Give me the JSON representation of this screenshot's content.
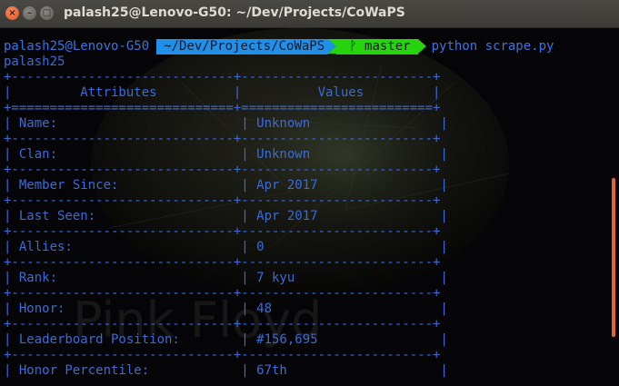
{
  "window": {
    "title": "palash25@Lenovo-G50: ~/Dev/Projects/CoWaPS"
  },
  "prompt": {
    "user_host": "palash25@Lenovo-G50",
    "directory": "~/Dev/Projects/CoWaPS",
    "branch": "master",
    "branch_icon": "git-branch-icon",
    "command": "python scrape.py"
  },
  "output_user": "palash25",
  "table": {
    "border": "+-----------------------------+-------------------------+",
    "header_sep": "+=============================+=========================+",
    "header": "|         Attributes          |          Values         |",
    "rows": [
      "| Name:                        | Unknown                 |",
      "| Clan:                        | Unknown                 |",
      "| Member Since:                | Apr 2017                |",
      "| Last Seen:                   | Apr 2017                |",
      "| Allies:                      | 0                       |",
      "| Rank:                        | 7 kyu                   |",
      "| Honor:                       | 48                      |",
      "| Leaderboard Position:        | #156,695                |",
      "| Honor Percentile:            | 67th                    |"
    ],
    "header_cells": [
      "Attributes",
      "Values"
    ],
    "cells": [
      [
        "Name:",
        "Unknown"
      ],
      [
        "Clan:",
        "Unknown"
      ],
      [
        "Member Since:",
        "Apr 2017"
      ],
      [
        "Last Seen:",
        "Apr 2017"
      ],
      [
        "Allies:",
        "0"
      ],
      [
        "Rank:",
        "7 kyu"
      ],
      [
        "Honor:",
        "48"
      ],
      [
        "Leaderboard Position:",
        "#156,695"
      ],
      [
        "Honor Percentile:",
        "67th"
      ]
    ]
  },
  "colors": {
    "terminal_text": "#3a6bd8",
    "dir_segment": "#1f8fe8",
    "branch_segment": "#26d40e",
    "close_button": "#e0541e",
    "scrollbar": "#e2633a"
  }
}
